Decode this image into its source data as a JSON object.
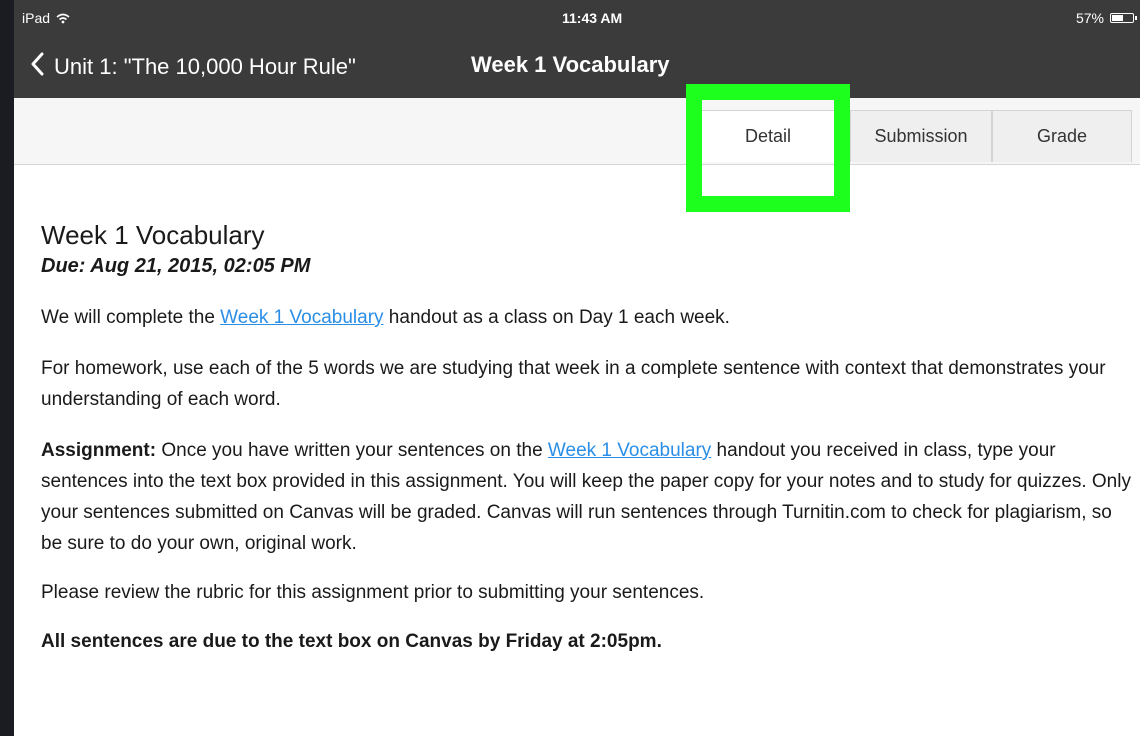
{
  "status": {
    "device": "iPad",
    "time": "11:43 AM",
    "battery": "57%",
    "battery_level": 0.57
  },
  "nav": {
    "back_label": "Unit 1: \"The 10,000 Hour Rule\"",
    "title": "Week 1 Vocabulary"
  },
  "tabs": [
    {
      "label": "Detail",
      "active": true
    },
    {
      "label": "Submission",
      "active": false
    },
    {
      "label": "Grade",
      "active": false
    }
  ],
  "assignment": {
    "title": "Week 1 Vocabulary",
    "due": "Due: Aug 21, 2015, 02:05 PM",
    "p1_before": " We will complete the ",
    "p1_link": "Week 1 Vocabulary",
    "p1_after": " handout as a class on Day 1 each week.",
    "p2": "For homework, use each of the 5 words we are studying that week in a complete sentence with context that demonstrates your understanding of each word.",
    "p3_label": "Assignment:",
    "p3_before": " Once you have written your sentences on the ",
    "p3_link": "Week 1 Vocabulary",
    "p3_after": " handout you received in class, type your sentences into the text box provided in this assignment. You will keep the paper copy for your notes and to study for quizzes. Only your sentences submitted on Canvas will be graded. Canvas will run sentences through Turnitin.com to check for plagiarism, so be sure to do your own, original work.",
    "p4": "Please review the rubric for this assignment prior to submitting your sentences.",
    "p5": "All sentences are due to the text box on Canvas by Friday at 2:05pm."
  },
  "colors": {
    "bar": "#3b3b3b",
    "link": "#2a8ee6",
    "highlight": "#1dff1d"
  }
}
